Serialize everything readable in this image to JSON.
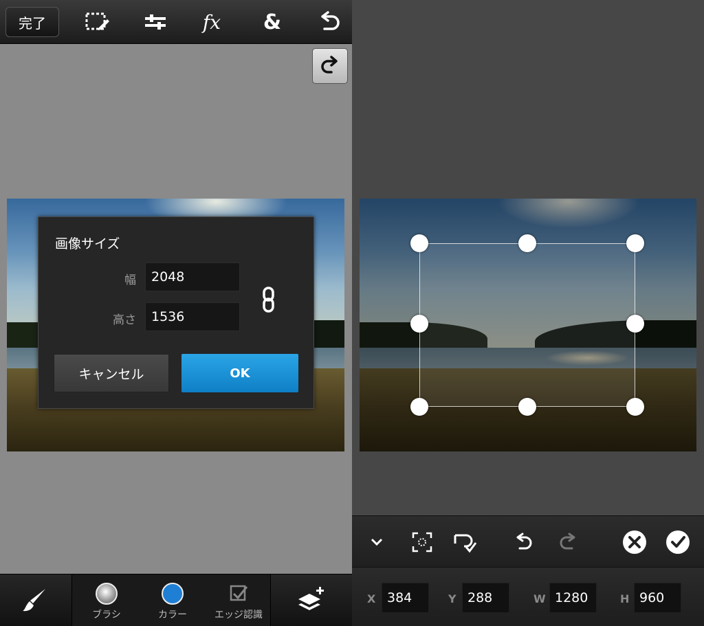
{
  "left": {
    "topbar": {
      "done_label": "完了",
      "icons": [
        "selection-edit-icon",
        "adjust-sliders-icon",
        "fx-icon",
        "ampersand-icon",
        "undo-icon"
      ],
      "fx_glyph": "fx",
      "amp_glyph": "&"
    },
    "redo_icon": "redo-icon",
    "dialog": {
      "title": "画像サイズ",
      "width_label": "幅",
      "width_value": "2048",
      "height_label": "高さ",
      "height_value": "1536",
      "link_icon": "chain-link-icon",
      "cancel_label": "キャンセル",
      "ok_label": "OK"
    },
    "bottombar": {
      "brush_icon": "paintbrush-icon",
      "tools": [
        {
          "label": "ブラシ",
          "icon": "brush-size-icon"
        },
        {
          "label": "カラー",
          "icon": "color-swatch-icon"
        },
        {
          "label": "エッジ認識",
          "icon": "edge-detect-icon"
        }
      ],
      "add_layer_icon": "add-layer-icon"
    }
  },
  "right": {
    "toolbar_icons": [
      "chevron-down-icon",
      "crop-center-icon",
      "rotate-confirm-icon",
      "undo-icon",
      "redo-icon",
      "cancel-icon",
      "confirm-icon"
    ],
    "coords": {
      "x_label": "X",
      "x_value": "384",
      "y_label": "Y",
      "y_value": "288",
      "w_label": "W",
      "w_value": "1280",
      "h_label": "H",
      "h_value": "960"
    }
  },
  "colors": {
    "ok_button": "#1f8fd8",
    "color_swatch": "#1f7fd4",
    "left_bg": "#8a8a8a",
    "right_bg": "#474747"
  }
}
